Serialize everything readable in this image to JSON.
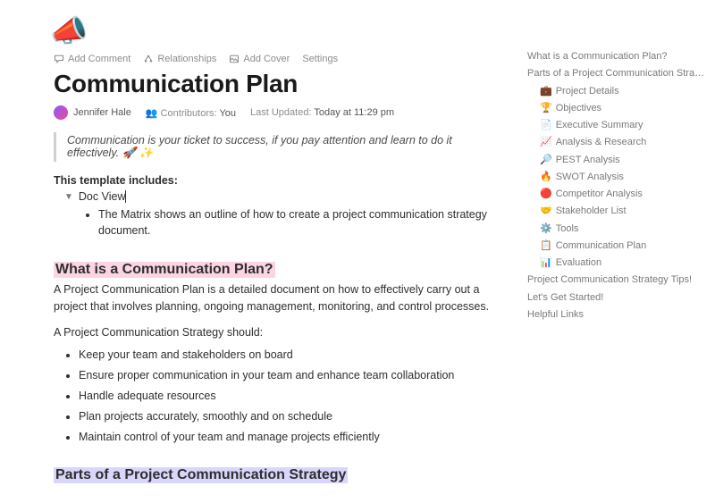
{
  "page_icon": "📣",
  "actions": {
    "add_comment": "Add Comment",
    "relationships": "Relationships",
    "add_cover": "Add Cover",
    "settings": "Settings"
  },
  "title": "Communication Plan",
  "meta": {
    "author": "Jennifer Hale",
    "contributors_label": "Contributors:",
    "contributors_value": "You",
    "updated_label": "Last Updated:",
    "updated_value": "Today at 11:29 pm"
  },
  "quote": "Communication is your ticket to success, if you pay attention and learn to do it effectively. 🚀 ✨",
  "template_includes_label": "This template includes:",
  "toggle": {
    "label": "Doc View",
    "bullet": "The Matrix shows an outline of how to create a project communication strategy document."
  },
  "section1": {
    "heading": "What is a Communication Plan?",
    "para": "A Project Communication Plan is a detailed document on how to effectively carry out a project that involves planning, ongoing management, monitoring, and control processes.",
    "list_intro": "A Project Communication Strategy should:",
    "items": [
      "Keep your team and stakeholders on board",
      "Ensure proper communication in your team and enhance team collaboration",
      "Handle adequate resources",
      "Plan projects accurately, smoothly and on schedule",
      "Maintain control of your team and manage projects efficiently"
    ]
  },
  "section2": {
    "heading": "Parts of a Project Communication Strategy"
  },
  "outline": {
    "top": [
      "What is a Communication Plan?",
      "Parts of a Project Communication Strategy"
    ],
    "sub": [
      {
        "icon": "💼",
        "label": "Project Details"
      },
      {
        "icon": "🏆",
        "label": "Objectives"
      },
      {
        "icon": "📄",
        "label": "Executive Summary"
      },
      {
        "icon": "📈",
        "label": "Analysis & Research"
      },
      {
        "icon": "🔎",
        "label": "PEST Analysis"
      },
      {
        "icon": "🔥",
        "label": "SWOT Analysis"
      },
      {
        "icon": "🔴",
        "label": "Competitor Analysis"
      },
      {
        "icon": "🤝",
        "label": "Stakeholder List"
      },
      {
        "icon": "⚙️",
        "label": "Tools"
      },
      {
        "icon": "📋",
        "label": "Communication Plan"
      },
      {
        "icon": "📊",
        "label": "Evaluation"
      }
    ],
    "bottom": [
      "Project Communication Strategy Tips!",
      "Let's Get Started!",
      "Helpful Links"
    ]
  }
}
